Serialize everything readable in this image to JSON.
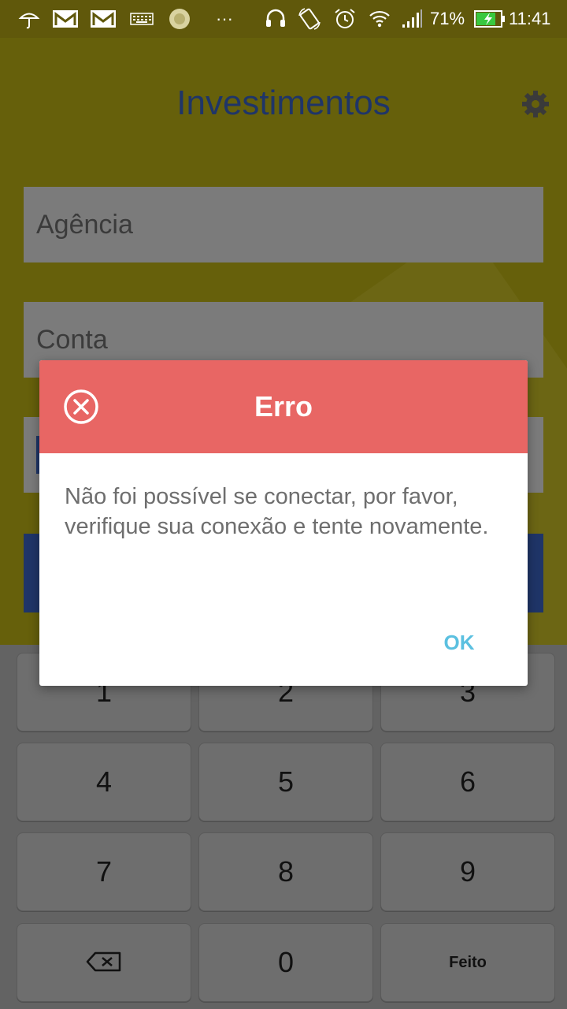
{
  "status_bar": {
    "battery_percent": "71%",
    "time": "11:41",
    "overflow_dots": "···",
    "icons": [
      "weather-umbrella-icon",
      "gmail-icon",
      "gmail-icon",
      "keyboard-icon",
      "sun-icon",
      "headset-icon",
      "screen-rotate-icon",
      "alarm-icon",
      "wifi-icon",
      "signal-icon",
      "battery-charging-icon"
    ]
  },
  "app": {
    "title": "Investimentos",
    "settings_icon": "gear-icon",
    "fields": {
      "agencia_placeholder": "Agência",
      "conta_placeholder": "Conta"
    }
  },
  "keypad": {
    "keys": [
      "1",
      "2",
      "3",
      "4",
      "5",
      "6",
      "7",
      "8",
      "9",
      "",
      "0",
      "Feito"
    ],
    "backspace_icon": "backspace-icon"
  },
  "dialog": {
    "title": "Erro",
    "icon": "error-circle-x-icon",
    "message": "Não foi possível se conectar, por favor, verifique sua conexão e tente novamente.",
    "ok_label": "OK"
  },
  "colors": {
    "dialog_header": "#e86664",
    "ok_button": "#5bc0e0",
    "title_text": "#1f3568",
    "app_background_dimmed": "#66600b"
  }
}
